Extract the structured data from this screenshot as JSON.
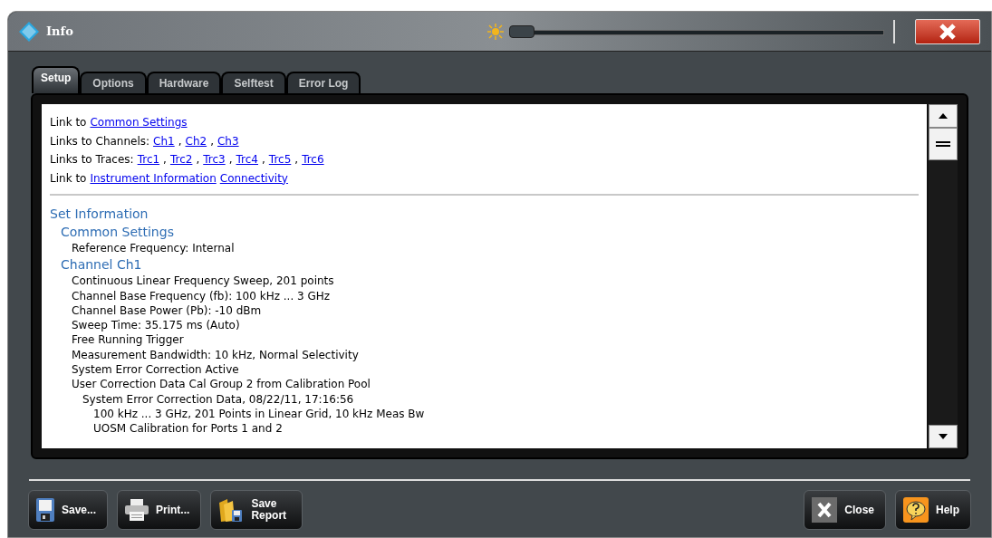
{
  "window": {
    "title": "Info"
  },
  "brightness": {
    "level": 0
  },
  "tabs": [
    {
      "label": "Setup",
      "selected": true
    },
    {
      "label": "Options",
      "selected": false
    },
    {
      "label": "Hardware",
      "selected": false
    },
    {
      "label": "Selftest",
      "selected": false
    },
    {
      "label": "Error Log",
      "selected": false
    }
  ],
  "link_lines": [
    {
      "label": "Link to",
      "links": [
        "Common Settings"
      ]
    },
    {
      "label": "Links to Channels:",
      "separator": ",",
      "links": [
        "Ch1",
        "Ch2",
        "Ch3"
      ]
    },
    {
      "label": "Links to Traces:",
      "separator": ",",
      "links": [
        "Trc1",
        "Trc2",
        "Trc3",
        "Trc4",
        "Trc5",
        "Trc6"
      ]
    },
    {
      "label": "Link to",
      "links": [
        "Instrument Information",
        "Connectivity"
      ]
    }
  ],
  "info": [
    {
      "kind": "heading",
      "text": "Set Information",
      "children": [
        {
          "kind": "heading",
          "text": "Common Settings",
          "children": [
            {
              "kind": "text",
              "text": "Reference Frequency: Internal"
            }
          ]
        },
        {
          "kind": "heading",
          "text": "Channel Ch1",
          "children": [
            {
              "kind": "text",
              "text": "Continuous Linear Frequency Sweep, 201 points"
            },
            {
              "kind": "text",
              "text": "Channel Base Frequency (fb): 100 kHz ... 3 GHz"
            },
            {
              "kind": "text",
              "text": "Channel Base Power (Pb): -10 dBm"
            },
            {
              "kind": "text",
              "text": "Sweep Time: 35.175 ms (Auto)"
            },
            {
              "kind": "text",
              "text": "Free Running Trigger"
            },
            {
              "kind": "text",
              "text": "Measurement Bandwidth: 10 kHz, Normal Selectivity"
            },
            {
              "kind": "text",
              "text": "System Error Correction Active"
            },
            {
              "kind": "text",
              "text": "User Correction Data Cal Group 2 from Calibration Pool",
              "children": [
                {
                  "kind": "text",
                  "text": "System Error Correction Data, 08/22/11, 17:16:56",
                  "children": [
                    {
                      "kind": "text",
                      "text": "100 kHz ... 3 GHz, 201 Points in Linear Grid, 10 kHz Meas Bw"
                    },
                    {
                      "kind": "text",
                      "text": "UOSM Calibration for Ports 1 and 2"
                    }
                  ]
                }
              ]
            }
          ]
        }
      ]
    }
  ],
  "buttons_left": [
    {
      "kind": "save",
      "label": "Save..."
    },
    {
      "kind": "print",
      "label": "Print..."
    },
    {
      "kind": "report",
      "label": "Save Report"
    }
  ],
  "buttons_right": [
    {
      "kind": "close",
      "label": "Close"
    },
    {
      "kind": "help",
      "label": "Help"
    }
  ]
}
